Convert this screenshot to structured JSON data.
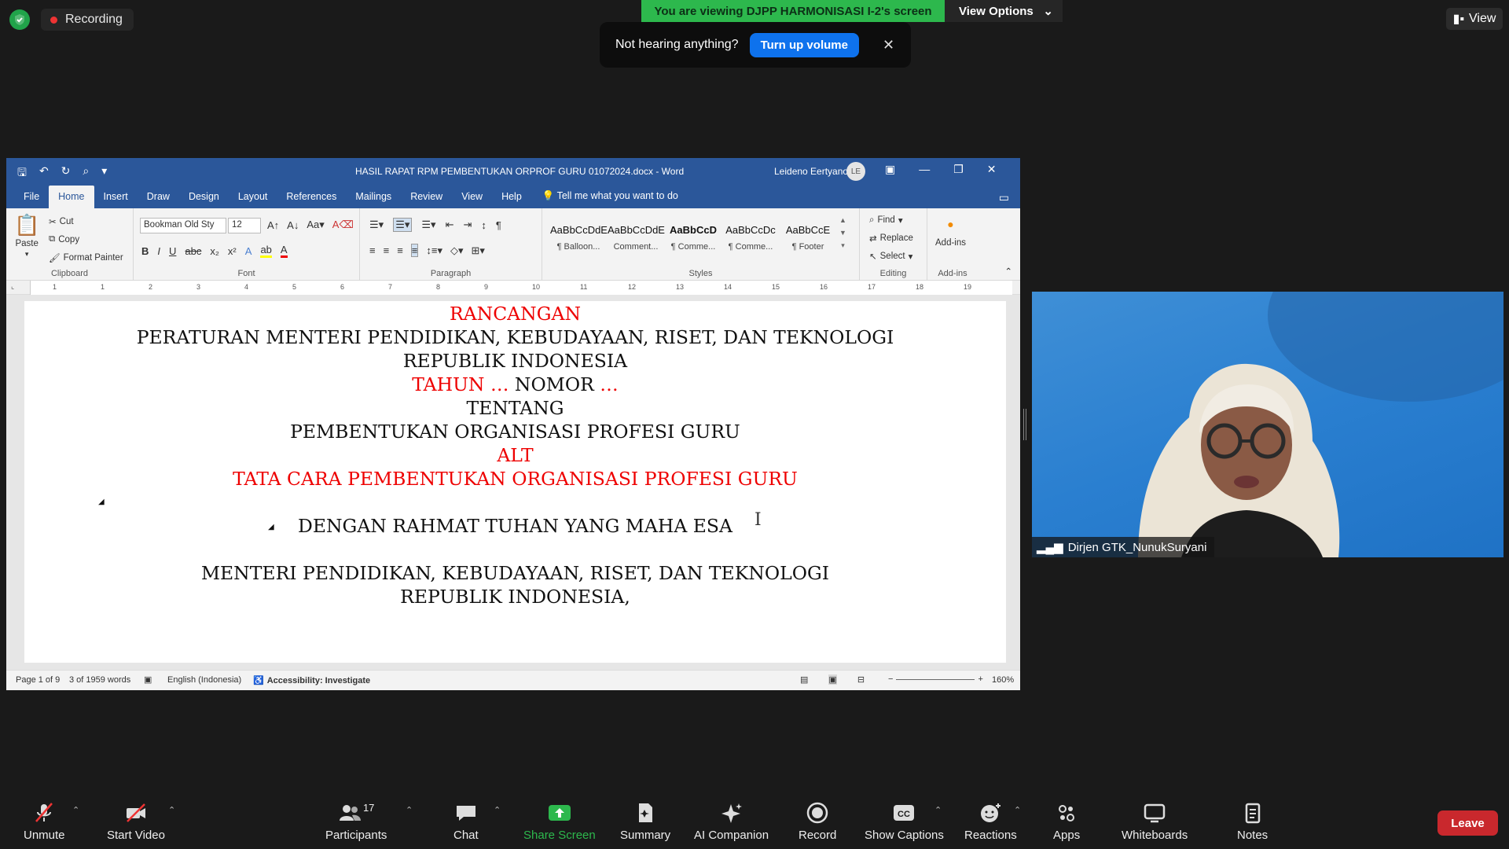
{
  "zoom": {
    "recording_label": "Recording",
    "viewing_banner": "You are viewing DJPP HARMONISASI I-2's screen",
    "view_options": "View Options",
    "view_button": "View",
    "toast": {
      "message": "Not hearing anything?",
      "button": "Turn up volume",
      "close": "✕"
    },
    "participant_name": "Dirjen GTK_NunukSuryani",
    "participants_count": "17",
    "toolbar": {
      "unmute": "Unmute",
      "start_video": "Start Video",
      "participants": "Participants",
      "chat": "Chat",
      "share_screen": "Share Screen",
      "summary": "Summary",
      "ai_companion": "AI Companion",
      "record": "Record",
      "show_captions": "Show Captions",
      "reactions": "Reactions",
      "apps": "Apps",
      "whiteboards": "Whiteboards",
      "notes": "Notes",
      "leave": "Leave"
    },
    "colors": {
      "share_green": "#2db84d",
      "leave_red": "#c9282d",
      "accent_blue": "#0e72ed"
    }
  },
  "word": {
    "title": "HASIL RAPAT RPM PEMBENTUKAN ORPROF GURU 01072024.docx  -  Word",
    "user": "Leideno Eertyano",
    "user_initials": "LE",
    "menu_tabs": [
      "File",
      "Home",
      "Insert",
      "Draw",
      "Design",
      "Layout",
      "References",
      "Mailings",
      "Review",
      "View",
      "Help"
    ],
    "tell_me": "Tell me what you want to do",
    "ribbon": {
      "clipboard": {
        "paste": "Paste",
        "cut": "Cut",
        "copy": "Copy",
        "format_painter": "Format Painter",
        "label": "Clipboard"
      },
      "font": {
        "name": "Bookman Old Sty",
        "size": "12",
        "label": "Font"
      },
      "paragraph": {
        "label": "Paragraph"
      },
      "styles": {
        "items": [
          {
            "sample": "AaBbCcDdE",
            "name": "¶ Balloon..."
          },
          {
            "sample": "AaBbCcDdE",
            "name": "Comment..."
          },
          {
            "sample": "AaBbCcD",
            "name": "¶ Comme..."
          },
          {
            "sample": "AaBbCcDc",
            "name": "¶ Comme..."
          },
          {
            "sample": "AaBbCcE",
            "name": "¶ Footer"
          }
        ],
        "label": "Styles"
      },
      "editing": {
        "find": "Find",
        "replace": "Replace",
        "select": "Select",
        "label": "Editing"
      },
      "addins": {
        "button": "Add-ins",
        "label": "Add-ins"
      }
    },
    "ruler_numbers": [
      "1",
      "1",
      "2",
      "3",
      "4",
      "5",
      "6",
      "7",
      "8",
      "9",
      "10",
      "11",
      "12",
      "13",
      "14",
      "15",
      "16",
      "17",
      "18",
      "19"
    ],
    "document_lines": [
      {
        "text": "RANCANGAN",
        "red": true
      },
      {
        "text": "PERATURAN MENTERI PENDIDIKAN, KEBUDAYAAN, RISET, DAN TEKNOLOGI"
      },
      {
        "text": "REPUBLIK INDONESIA"
      },
      {
        "text": "TENTANG"
      },
      {
        "text": "PEMBENTUKAN ORGANISASI PROFESI GURU"
      },
      {
        "text": "ALT",
        "red": true
      },
      {
        "text": "TATA CARA PEMBENTUKAN ORGANISASI PROFESI GURU",
        "red": true
      },
      {
        "text": "DENGAN RAHMAT TUHAN YANG MAHA ESA"
      },
      {
        "text": "MENTERI PENDIDIKAN, KEBUDAYAAN, RISET, DAN TEKNOLOGI"
      },
      {
        "text": "REPUBLIK INDONESIA,"
      }
    ],
    "tahun_line": {
      "tahun": "TAHUN …",
      "nomor": " NOMOR ",
      "dots": "…"
    },
    "status": {
      "page": "Page 1 of 9",
      "words": "3 of 1959 words",
      "language": "English (Indonesia)",
      "accessibility": "Accessibility: Investigate",
      "zoom": "160%"
    },
    "colors": {
      "title_blue": "#2b579a",
      "red_text": "#ee0000"
    }
  }
}
